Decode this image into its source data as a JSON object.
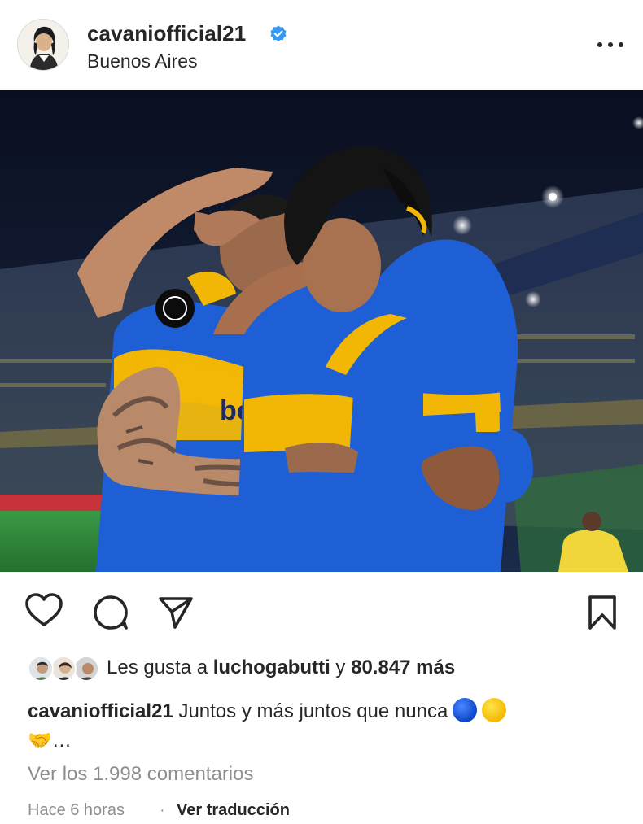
{
  "post": {
    "username": "cavaniofficial21",
    "location": "Buenos Aires",
    "verified": true,
    "more_icon": "more-horizontal-icon"
  },
  "photo": {
    "jersey_text": "be",
    "colors": {
      "jersey_blue": "#1f5fd6",
      "jersey_yellow": "#f2b705",
      "pitch": "#2f8a3a",
      "sky": "#0d1426"
    }
  },
  "actions": {
    "like_icon": "heart-icon",
    "comment_icon": "comment-icon",
    "share_icon": "paper-plane-icon",
    "save_icon": "bookmark-icon"
  },
  "likes": {
    "prefix": "Les gusta a",
    "user": "luchogabutti",
    "middle": "y",
    "count": "80.847 más"
  },
  "caption": {
    "username": "cavaniofficial21",
    "text": "Juntos y más juntos que nunca",
    "line2": "🤝…",
    "emojis": [
      "blue-circle",
      "yellow-circle",
      "handshake"
    ]
  },
  "comments_link": "Ver los 1.998 comentarios",
  "footer": {
    "time": "Hace 6 horas",
    "separator": "·",
    "translate": "Ver traducción"
  },
  "colors": {
    "text": "#262626",
    "muted": "#8e8e8e",
    "verified_blue": "#3897f0"
  }
}
